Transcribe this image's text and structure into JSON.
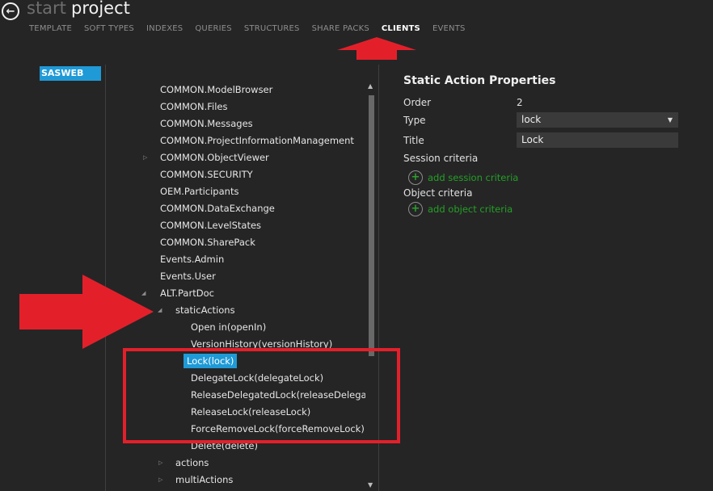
{
  "header": {
    "back_icon": "arrow-left-icon",
    "breadcrumb_start": "start",
    "breadcrumb_project": "project"
  },
  "nav": {
    "tabs": [
      {
        "label": "TEMPLATE",
        "active": false
      },
      {
        "label": "SOFT TYPES",
        "active": false
      },
      {
        "label": "INDEXES",
        "active": false
      },
      {
        "label": "QUERIES",
        "active": false
      },
      {
        "label": "STRUCTURES",
        "active": false
      },
      {
        "label": "SHARE PACKS",
        "active": false
      },
      {
        "label": "CLIENTS",
        "active": true
      },
      {
        "label": "EVENTS",
        "active": false
      }
    ]
  },
  "clients": {
    "items": [
      "SASWEB"
    ]
  },
  "tree": {
    "nodes": [
      {
        "label": "COMMON.ModelBrowser"
      },
      {
        "label": "COMMON.Files"
      },
      {
        "label": "COMMON.Messages"
      },
      {
        "label": "COMMON.ProjectInformationManagement"
      },
      {
        "label": "COMMON.ObjectViewer"
      },
      {
        "label": "COMMON.SECURITY"
      },
      {
        "label": "OEM.Participants"
      },
      {
        "label": "COMMON.DataExchange"
      },
      {
        "label": "COMMON.LevelStates"
      },
      {
        "label": "COMMON.SharePack"
      },
      {
        "label": "Events.Admin"
      },
      {
        "label": "Events.User"
      },
      {
        "label": "ALT.PartDoc"
      },
      {
        "label": "staticActions"
      },
      {
        "label": "Open in(openIn)"
      },
      {
        "label": "VersionHistory(versionHistory)"
      },
      {
        "label": "Lock(lock)"
      },
      {
        "label": "DelegateLock(delegateLock)"
      },
      {
        "label": "ReleaseDelegatedLock(releaseDelegatedL"
      },
      {
        "label": "ReleaseLock(releaseLock)"
      },
      {
        "label": "ForceRemoveLock(forceRemoveLock)"
      },
      {
        "label": "Delete(delete)"
      },
      {
        "label": "actions"
      },
      {
        "label": "multiActions"
      }
    ]
  },
  "properties": {
    "title": "Static Action Properties",
    "order_label": "Order",
    "order_value": "2",
    "type_label": "Type",
    "type_value": "lock",
    "title_label": "Title",
    "title_value": "Lock",
    "session_label": "Session criteria",
    "add_session": "add session criteria",
    "object_label": "Object criteria",
    "add_object": "add object criteria"
  },
  "colors": {
    "background": "#252526",
    "selection": "#1f9ad6",
    "add_link": "#24a024",
    "annotation": "#e3202a"
  }
}
